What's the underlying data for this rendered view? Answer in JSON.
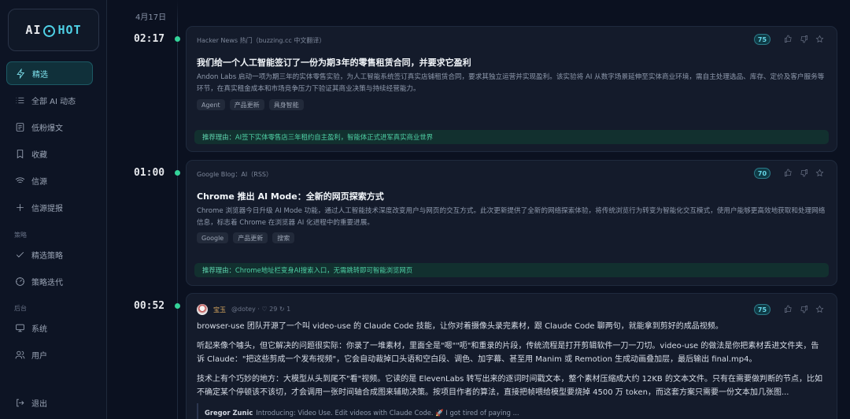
{
  "app": {
    "logo_prefix": "AI",
    "logo_suffix": "HOT",
    "accent": "#4fd1e6"
  },
  "sidebar": {
    "items": [
      {
        "label": "精选",
        "icon": "lightning-icon",
        "active": true
      },
      {
        "label": "全部 AI 动态",
        "icon": "list-icon"
      },
      {
        "label": "低粉爆文",
        "icon": "document-icon"
      },
      {
        "label": "收藏",
        "icon": "bookmark-icon"
      },
      {
        "label": "信源",
        "icon": "wifi-icon"
      },
      {
        "label": "信源提报",
        "icon": "plus-icon"
      }
    ],
    "section_strategy": "策略",
    "strategy_items": [
      {
        "label": "精选策略",
        "icon": "check-icon"
      },
      {
        "label": "策略迭代",
        "icon": "gauge-icon"
      }
    ],
    "section_admin": "后台",
    "admin_items": [
      {
        "label": "系统",
        "icon": "monitor-icon"
      },
      {
        "label": "用户",
        "icon": "users-icon"
      }
    ],
    "logout": "退出"
  },
  "timeline": {
    "date": "4月17日",
    "entries": [
      {
        "time": "02:17",
        "source": "Hacker News 热门（buzzing.cc 中文翻译）",
        "score": "75",
        "title": "我们给一个人工智能签订了一份为期3年的零售租赁合同，并要求它盈利",
        "desc": "Andon Labs 启动一项为期三年的实体零售实验，为人工智能系统签订真实店铺租赁合同，要求其独立运营并实现盈利。该实验将 AI 从数字场景延伸至实体商业环境，需自主处理选品、库存、定价及客户服务等环节，在真实租金成本和市场竞争压力下验证其商业决策与持续经营能力。",
        "tags": [
          "Agent",
          "产品更新",
          "具身智能"
        ],
        "reason_label": "推荐理由：",
        "reason": "AI签下实体零售店三年租约自主盈利，智能体正式进军真实商业世界"
      },
      {
        "time": "01:00",
        "source": "Google Blog：AI（RSS）",
        "score": "70",
        "title": "Chrome 推出 AI Mode：全新的网页探索方式",
        "desc": "Chrome 浏览器今日升级 AI Mode 功能，通过人工智能技术深度改变用户与网页的交互方式。此次更新提供了全新的网络探索体验，将传统浏览行为转变为智能化交互模式，使用户能够更高效地获取和处理网络信息，标志着 Chrome 在浏览器 AI 化进程中的重要进展。",
        "tags": [
          "Google",
          "产品更新",
          "搜索"
        ],
        "reason_label": "推荐理由：",
        "reason": "Chrome地址栏变身AI搜索入口，无需跳转即可智能浏览网页"
      },
      {
        "time": "00:52",
        "author": "宝玉",
        "author_meta": "@dotey · ♡ 29 ↻ 1",
        "score": "75",
        "p1": "browser-use 团队开源了一个叫 video-use 的 Claude Code 技能，让你对着摄像头录完素材，跟 Claude Code 聊两句，就能拿到剪好的成品视频。",
        "p2": "听起来像个噱头，但它解决的问题很实际：你录了一堆素材，里面全是\"嗯\"\"呃\"和重录的片段，传统流程是打开剪辑软件一刀一刀切。video-use 的做法是你把素材丢进文件夹，告诉 Claude：\"把这些剪成一个发布视频\"，它会自动裁掉口头语和空白段、调色、加字幕、甚至用 Manim 或 Remotion 生成动画叠加层，最后输出 final.mp4。",
        "p3": "技术上有个巧妙的地方：大模型从头到尾不\"看\"视频。它读的是 ElevenLabs 转写出来的逐词时间戳文本，整个素材压缩成大约 12KB 的文本文件。只有在需要做判断的节点，比如不确定某个停顿该不该切，才会调用一张时间轴合成图来辅助决策。按项目作者的算法，直接把帧喂给模型要烧掉 4500 万 token，而这套方案只需要一份文本加几张图...",
        "quote_author": "Gregor Zunic",
        "quote_text": "Introducing: Video Use. Edit videos with Claude Code. 🚀 I got tired of paying ..."
      }
    ]
  }
}
